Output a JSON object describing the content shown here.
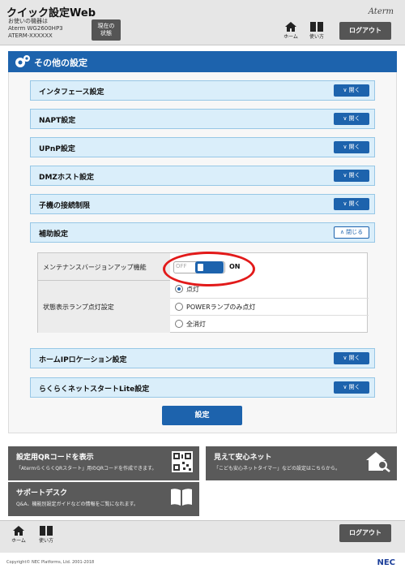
{
  "header": {
    "app_title": "クイック設定Web",
    "device_lines": [
      "お使いの機器は",
      "Aterm WG2600HP3",
      "ATERM-XXXXXX"
    ],
    "status_button": [
      "現在の",
      "状態"
    ],
    "logo": "Aterm",
    "home_label": "ホーム",
    "help_label": "使い方",
    "logout_label": "ログアウト"
  },
  "section": {
    "title": "その他の設定"
  },
  "accordions": {
    "interface": "インタフェース設定",
    "napt": "NAPT設定",
    "upnp": "UPnP設定",
    "dmz": "DMZホスト設定",
    "child_limit": "子機の接続制限",
    "aux": "補助設定",
    "home_ip": "ホームIPロケーション設定",
    "rakuraku": "らくらくネットスタートLite設定",
    "open_label": "開く",
    "close_label": "閉じる"
  },
  "aux_settings": {
    "maintenance_label": "メンテナンスバージョンアップ機能",
    "toggle_off": "OFF",
    "toggle_on": "ON",
    "lamp_label": "状態表示ランプ点灯設定",
    "lamp_options": [
      "点灯",
      "POWERランプのみ点灯",
      "全消灯"
    ],
    "lamp_selected": 0
  },
  "submit_label": "設定",
  "tiles": {
    "qr_title": "設定用QRコードを表示",
    "qr_desc": "「AtermらくらくQRスタート」用のQRコードを作成できます。",
    "safe_title": "見えて安心ネット",
    "safe_desc": "「こども安心ネットタイマー」などの設定はこちらから。",
    "support_title": "サポートデスク",
    "support_desc": "Q&A、機能別設定ガイドなどの情報をご覧になれます。"
  },
  "footer": {
    "home_label": "ホーム",
    "help_label": "使い方",
    "logout_label": "ログアウト",
    "copyright": "Copyright© NEC Platforms, Ltd. 2001-2018",
    "brand": "NEC"
  },
  "colors": {
    "primary": "#1d63ad",
    "accordion_bg": "#daeefa",
    "highlight_ring": "#e21a1a",
    "tile_bg": "#5a5a5a"
  }
}
